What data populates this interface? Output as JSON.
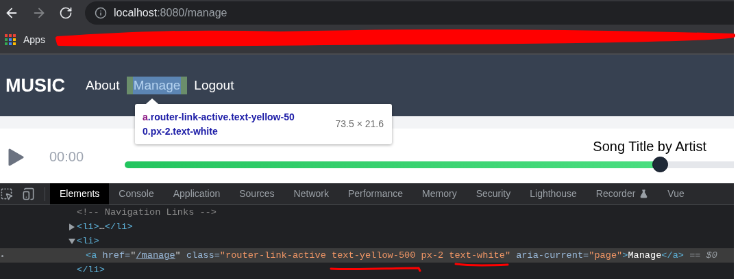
{
  "browser": {
    "address": {
      "host": "localhost",
      "rest": ":8080/manage"
    },
    "bookmarks": [
      {
        "label": "Apps"
      }
    ]
  },
  "app": {
    "logo": "MUSIC",
    "nav_links": [
      {
        "label": "About",
        "selected": false
      },
      {
        "label": "Manage",
        "selected": true
      },
      {
        "label": "Logout",
        "selected": false
      }
    ]
  },
  "inspect_tooltip": {
    "tag": "a",
    "selector": ".router-link-active.text-yellow-500.px-2.text-white",
    "size": "73.5 × 21.6"
  },
  "player": {
    "time": "00:00",
    "song": "Song Title by Artist",
    "level": 0.878
  },
  "devtools": {
    "tabs": [
      {
        "label": "Elements",
        "selected": true
      },
      {
        "label": "Console",
        "selected": false
      },
      {
        "label": "Application",
        "selected": false
      },
      {
        "label": "Sources",
        "selected": false
      },
      {
        "label": "Network",
        "selected": false
      },
      {
        "label": "Performance",
        "selected": false
      },
      {
        "label": "Memory",
        "selected": false
      },
      {
        "label": "Security",
        "selected": false
      },
      {
        "label": "Lighthouse",
        "selected": false
      },
      {
        "label": "Recorder",
        "selected": false,
        "experimental": true
      },
      {
        "label": "Vue",
        "selected": false
      }
    ],
    "dom_tree": [
      {
        "kind": "leaf",
        "selected": false,
        "tokens": [
          {
            "kind": "comment",
            "text": "<!-- Navigation Links -->"
          }
        ]
      },
      {
        "kind": "parent",
        "selected": false,
        "expanded": false,
        "tokens": [
          {
            "kind": "tag",
            "text": "<li>"
          },
          {
            "kind": "text",
            "text": "…"
          },
          {
            "kind": "tag",
            "text": "</li>"
          }
        ]
      },
      {
        "kind": "parent",
        "selected": false,
        "expanded": true,
        "tokens": [
          {
            "kind": "tag",
            "text": "<li>"
          }
        ],
        "children": [
          {
            "kind": "leaf",
            "selected": true,
            "tokens": [
              {
                "kind": "tag",
                "text": "<a"
              },
              {
                "kind": "attr",
                "text": " href="
              },
              {
                "kind": "punct",
                "text": "\""
              },
              {
                "kind": "link",
                "text": "/manage"
              },
              {
                "kind": "punct",
                "text": "\""
              },
              {
                "kind": "attr",
                "text": " class="
              },
              {
                "kind": "value",
                "text": "\"router-link-active text-yellow-500 px-2 text-white\""
              },
              {
                "kind": "attr",
                "text": " aria-current="
              },
              {
                "kind": "value",
                "text": "\"page\""
              },
              {
                "kind": "tag",
                "text": ">"
              },
              {
                "kind": "text",
                "text": "Manage"
              },
              {
                "kind": "tag",
                "text": "</a>"
              },
              {
                "kind": "hint",
                "text": " == $0"
              }
            ]
          }
        ],
        "close_tokens": [
          {
            "kind": "tag",
            "text": "</li>"
          }
        ]
      }
    ]
  }
}
